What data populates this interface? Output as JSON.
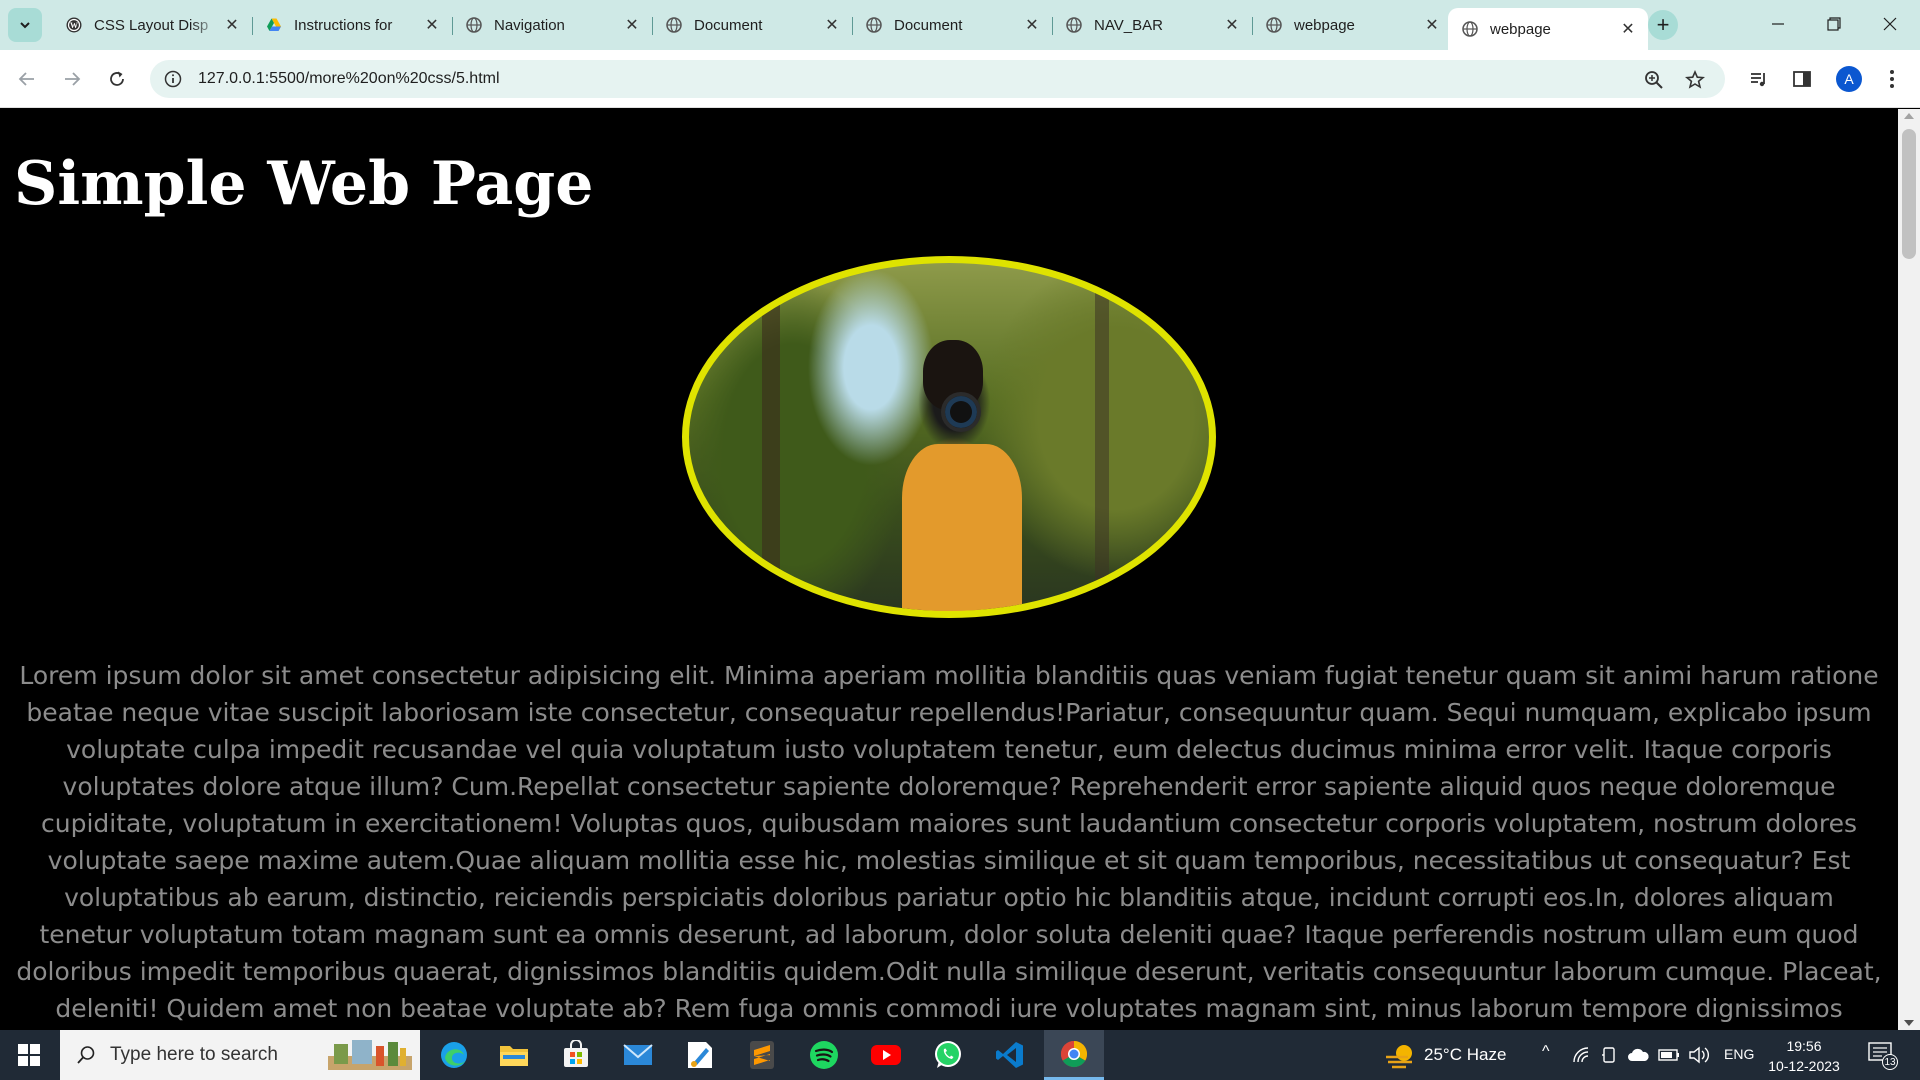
{
  "browser": {
    "tabs": [
      {
        "title": "CSS Layout Disp",
        "favicon": "wordpress-icon",
        "active": false
      },
      {
        "title": "Instructions for",
        "favicon": "google-drive-icon",
        "active": false
      },
      {
        "title": "Navigation",
        "favicon": "globe-icon",
        "active": false
      },
      {
        "title": "Document",
        "favicon": "globe-icon",
        "active": false
      },
      {
        "title": "Document",
        "favicon": "globe-icon",
        "active": false
      },
      {
        "title": "NAV_BAR",
        "favicon": "globe-icon",
        "active": false
      },
      {
        "title": "webpage",
        "favicon": "globe-icon",
        "active": false
      },
      {
        "title": "webpage",
        "favicon": "globe-icon",
        "active": true
      }
    ],
    "url": "127.0.0.1:5500/more%20on%20css/5.html",
    "profile_initial": "A"
  },
  "page": {
    "title": "Simple Web Page",
    "image_border_color": "#dfe300",
    "paragraph": "Lorem ipsum dolor sit amet consectetur adipisicing elit. Minima aperiam mollitia blanditiis quas veniam fugiat tenetur quam sit animi harum ratione beatae neque vitae suscipit laboriosam iste consectetur, consequatur repellendus!Pariatur, consequuntur quam. Sequi numquam, explicabo ipsum voluptate culpa impedit recusandae vel quia voluptatum iusto voluptatem tenetur, eum delectus ducimus minima error velit. Itaque corporis voluptates dolore atque illum? Cum.Repellat consectetur sapiente doloremque? Reprehenderit error sapiente aliquid quos neque doloremque cupiditate, voluptatum in exercitationem! Voluptas quos, quibusdam maiores sunt laudantium consectetur corporis voluptatem, nostrum dolores voluptate saepe maxime autem.Quae aliquam mollitia esse hic, molestias similique et sit quam temporibus, necessitatibus ut consequatur? Est voluptatibus ab earum, distinctio, reiciendis perspiciatis doloribus pariatur optio hic blanditiis atque, incidunt corrupti eos.In, dolores aliquam tenetur voluptatum totam magnam sunt ea omnis deserunt, ad laborum, dolor soluta deleniti quae? Itaque perferendis nostrum ullam eum quod doloribus impedit temporibus quaerat, dignissimos blanditiis quidem.Odit nulla similique deserunt, veritatis consequuntur laborum cumque. Placeat, deleniti! Quidem amet non beatae voluptate ab? Rem fuga omnis commodi iure voluptates magnam sint, minus laborum tempore dignissimos itaque ut.Nulla soluta quis, earum tenetur"
  },
  "taskbar": {
    "search_placeholder": "Type here to search",
    "weather": "25°C  Haze",
    "language": "ENG",
    "time": "19:56",
    "date": "10-12-2023",
    "notification_count": "13",
    "apps": [
      "edge-icon",
      "file-explorer-icon",
      "microsoft-store-icon",
      "mail-icon",
      "paint-icon",
      "sublime-text-icon",
      "spotify-icon",
      "youtube-icon",
      "whatsapp-icon",
      "vscode-icon",
      "chrome-icon"
    ]
  }
}
